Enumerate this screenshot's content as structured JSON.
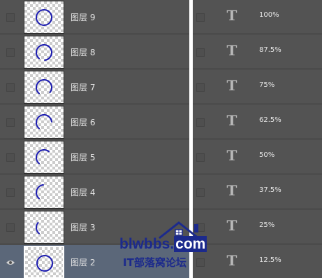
{
  "layers_panel": {
    "layers": [
      {
        "name": "图层 9",
        "arc": 1.0,
        "visible": false
      },
      {
        "name": "图层 8",
        "arc": 0.875,
        "visible": false
      },
      {
        "name": "图层 7",
        "arc": 0.75,
        "visible": false
      },
      {
        "name": "图层 6",
        "arc": 0.625,
        "visible": false
      },
      {
        "name": "图层 5",
        "arc": 0.5,
        "visible": false
      },
      {
        "name": "图层 4",
        "arc": 0.375,
        "visible": false
      },
      {
        "name": "图层 3",
        "arc": 0.25,
        "visible": false
      },
      {
        "name": "图层 2",
        "arc": 1.0,
        "visible": true,
        "selected": true
      }
    ]
  },
  "text_layers_panel": {
    "layers": [
      {
        "icon": "T",
        "label": "100%"
      },
      {
        "icon": "T",
        "label": "87.5%"
      },
      {
        "icon": "T",
        "label": "75%"
      },
      {
        "icon": "T",
        "label": "62.5%"
      },
      {
        "icon": "T",
        "label": "50%"
      },
      {
        "icon": "T",
        "label": "37.5%"
      },
      {
        "icon": "T",
        "label": "25%"
      },
      {
        "icon": "T",
        "label": "12.5%"
      }
    ]
  },
  "watermark": {
    "url_prefix": "blwbbs.",
    "url_suffix": "com",
    "subtitle": "IT部落窝论坛"
  },
  "colors": {
    "arc_stroke": "#1a1ab0",
    "panel_bg": "#535353",
    "selected_row": "#5b6779",
    "watermark": "#1c2a8c"
  }
}
